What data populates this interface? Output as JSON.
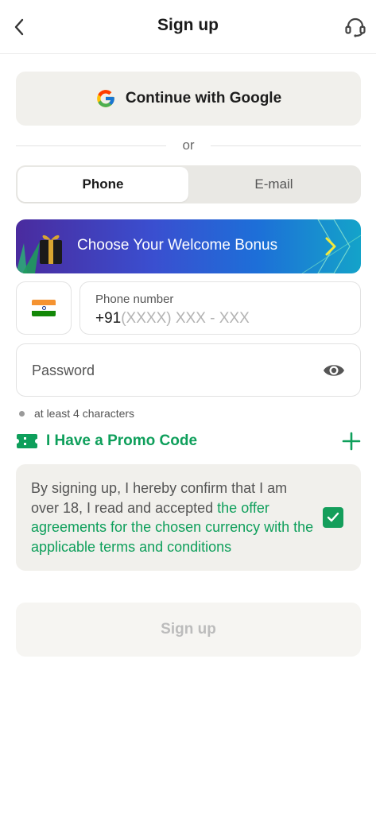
{
  "header": {
    "title": "Sign up",
    "back_icon": "chevron-left-icon",
    "support_icon": "headset-support-icon"
  },
  "google": {
    "label": "Continue with Google",
    "icon": "google-icon"
  },
  "divider": {
    "text": "or"
  },
  "tabs": [
    {
      "label": "Phone",
      "active": true
    },
    {
      "label": "E-mail",
      "active": false
    }
  ],
  "bonus": {
    "text": "Choose Your Welcome Bonus",
    "icon": "gift-icon",
    "arrow_icon": "chevron-right-icon"
  },
  "phone": {
    "country_flag": "india-flag-icon",
    "label": "Phone number",
    "prefix": "+91",
    "placeholder": "(XXXX) XXX - XXX"
  },
  "password": {
    "placeholder": "Password",
    "toggle_icon": "eye-icon"
  },
  "password_hint": "at least 4 characters",
  "promo": {
    "label": "I Have a Promo Code",
    "icon": "ticket-icon",
    "add_icon": "plus-icon"
  },
  "terms": {
    "text_plain": "By signing up, I hereby confirm that I am over 18, I read and accepted ",
    "text_link": "the offer agreements for the chosen currency with the applicable terms and conditions",
    "checked": true
  },
  "signup_button": {
    "label": "Sign up"
  },
  "colors": {
    "accent_green": "#0e9f5b",
    "field_border": "#e2e2e2",
    "panel_bg": "#f1f0ec"
  }
}
